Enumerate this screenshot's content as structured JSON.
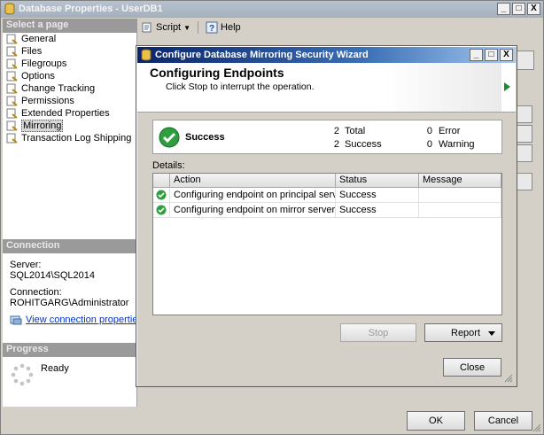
{
  "outer": {
    "title": "Database Properties - UserDB1",
    "window_buttons": [
      "_",
      "□",
      "X"
    ],
    "toolbar": {
      "script_label": "Script",
      "help_label": "Help"
    },
    "select_page_header": "Select a page",
    "pages": [
      "General",
      "Files",
      "Filegroups",
      "Options",
      "Change Tracking",
      "Permissions",
      "Extended Properties",
      "Mirroring",
      "Transaction Log Shipping"
    ],
    "selected_page": "Mirroring",
    "connection_header": "Connection",
    "server_label": "Server:",
    "server_value": "SQL2014\\SQL2014",
    "connection_label": "Connection:",
    "connection_value": "ROHITGARG\\Administrator",
    "view_connection_link": "View connection properties",
    "progress_header": "Progress",
    "progress_status": "Ready",
    "ok_label": "OK",
    "cancel_label": "Cancel"
  },
  "wizard": {
    "title": "Configure Database Mirroring Security Wizard",
    "window_buttons": [
      "_",
      "□",
      "X"
    ],
    "heading": "Configuring Endpoints",
    "subheading": "Click Stop to interrupt the operation.",
    "summary": {
      "status": "Success",
      "total_count": "2",
      "total_label": "Total",
      "success_count": "2",
      "success_label": "Success",
      "error_count": "0",
      "error_label": "Error",
      "warning_count": "0",
      "warning_label": "Warning"
    },
    "details_label": "Details:",
    "columns": [
      "Action",
      "Status",
      "Message"
    ],
    "rows": [
      {
        "action": "Configuring endpoint on principal server(...",
        "status": "Success",
        "message": ""
      },
      {
        "action": "Configuring endpoint on mirror server(S...",
        "status": "Success",
        "message": ""
      }
    ],
    "stop_label": "Stop",
    "report_label": "Report",
    "close_label": "Close"
  },
  "colors": {
    "success_green": "#1b8c2a",
    "link_blue": "#0033cc"
  }
}
